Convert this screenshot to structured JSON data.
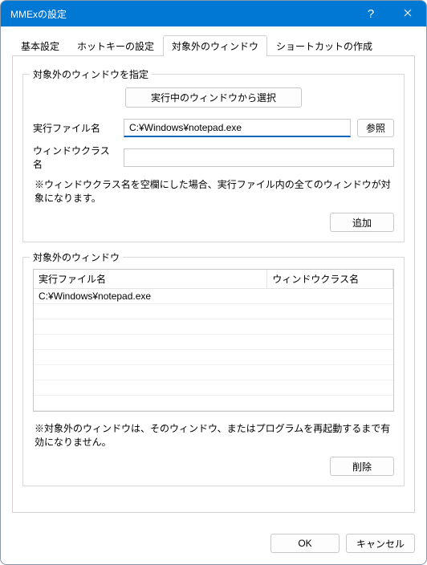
{
  "titlebar": {
    "title": "MMExの設定"
  },
  "tabs": {
    "t0": "基本設定",
    "t1": "ホットキーの設定",
    "t2": "対象外のウィンドウ",
    "t3": "ショートカットの作成"
  },
  "group1": {
    "title": "対象外のウィンドウを指定",
    "select_from_running": "実行中のウィンドウから選択",
    "exec_file_label": "実行ファイル名",
    "exec_file_value": "C:¥Windows¥notepad.exe",
    "window_class_label": "ウィンドウクラス名",
    "window_class_value": "",
    "browse": "参照",
    "note": "※ウィンドウクラス名を空欄にした場合、実行ファイル内の全てのウィンドウが対象になります。",
    "add": "追加"
  },
  "group2": {
    "title": "対象外のウィンドウ",
    "col_exec": "実行ファイル名",
    "col_class": "ウィンドウクラス名",
    "rows": [
      {
        "exec": "C:¥Windows¥notepad.exe",
        "cls": ""
      }
    ],
    "note2": "※対象外のウィンドウは、そのウィンドウ、またはプログラムを再起動するまで有効になりません。",
    "delete": "削除"
  },
  "footer": {
    "ok": "OK",
    "cancel": "キャンセル"
  }
}
